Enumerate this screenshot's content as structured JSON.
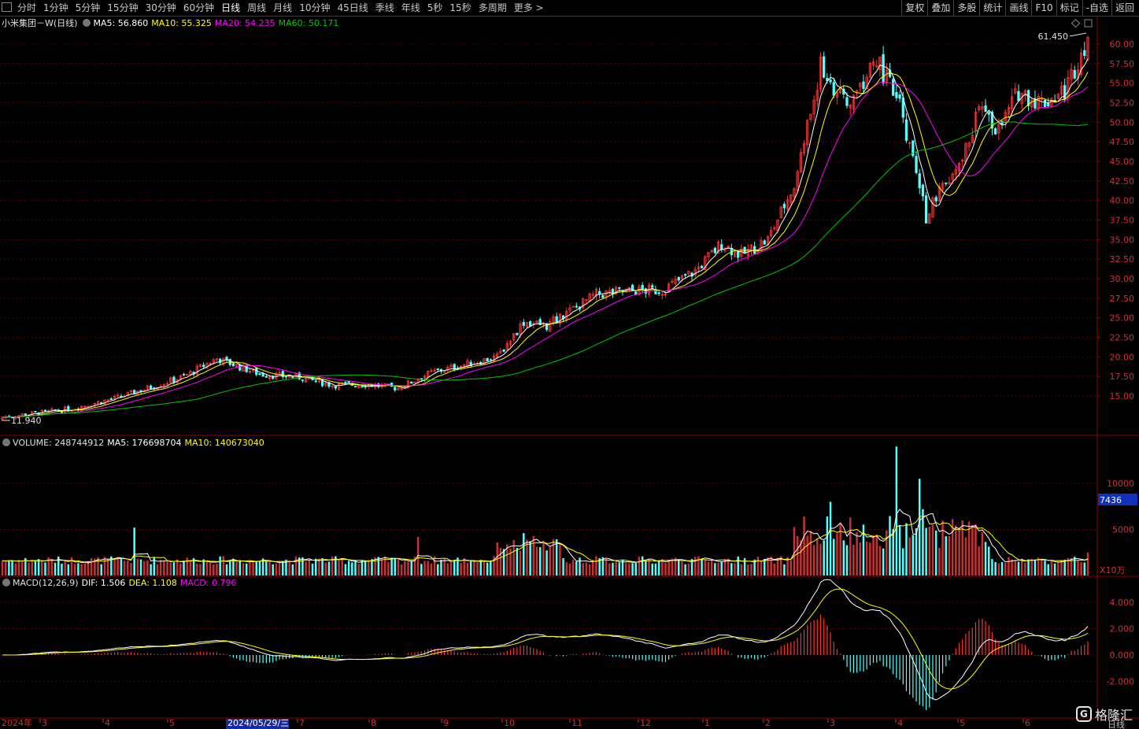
{
  "toolbar": {
    "left": [
      "分时",
      "1分钟",
      "5分钟",
      "15分钟",
      "30分钟",
      "60分钟",
      "日线",
      "周线",
      "月线",
      "10分钟",
      "45日线",
      "季线",
      "年线",
      "5秒",
      "15秒",
      "多周期",
      "更多 >"
    ],
    "active": "日线",
    "right": [
      "复权",
      "叠加",
      "多股",
      "统计",
      "画线",
      "F10",
      "标记",
      "-自选",
      "返回"
    ]
  },
  "price_header": {
    "name": "小米集团－W",
    "period": "(日线)",
    "ma5": "MA5: 56.860",
    "ma10": "MA10: 55.325",
    "ma20": "MA20: 54.235",
    "ma60": "MA60: 50.171"
  },
  "price_axis": [
    "60.00",
    "57.50",
    "55.00",
    "52.50",
    "50.00",
    "47.50",
    "45.00",
    "42.50",
    "40.00",
    "37.50",
    "35.00",
    "32.50",
    "30.00",
    "27.50",
    "25.00",
    "22.50",
    "20.00",
    "17.50",
    "15.00"
  ],
  "high_label": "61.450",
  "low_label": "11.940",
  "volume_header": {
    "volume": "VOLUME: 248744912",
    "ma5": "MA5: 176698704",
    "ma10": "MA10: 140673040"
  },
  "volume_axis": [
    "10000",
    "5000"
  ],
  "volume_current": "7436",
  "volume_unit": "X10万",
  "macd_header": {
    "name": "MACD(12,26,9)",
    "dif": "DIF: 1.506",
    "dea": "DEA: 1.108",
    "macd": "MACD: 0.796"
  },
  "macd_axis": [
    "4.000",
    "2.000",
    "0.000",
    "-2.000"
  ],
  "date_axis": {
    "year": "2024年",
    "months": [
      "3",
      "4",
      "5",
      "7",
      "8",
      "9",
      "10",
      "11",
      "12",
      "1",
      "2",
      "3",
      "4",
      "5",
      "6"
    ],
    "cursor_date": "2024/05/29/三",
    "period": "日线"
  },
  "logo": {
    "text": "格隆汇",
    "mark": "G"
  },
  "colors": {
    "up": "#ff3232",
    "down": "#54ffff",
    "ma5": "#ffffff",
    "ma10": "#ffff00",
    "ma20": "#ff00ff",
    "ma60": "#00c800",
    "grid": "#5a0000",
    "border": "#8b0000",
    "axis_text": "#d23232"
  }
}
